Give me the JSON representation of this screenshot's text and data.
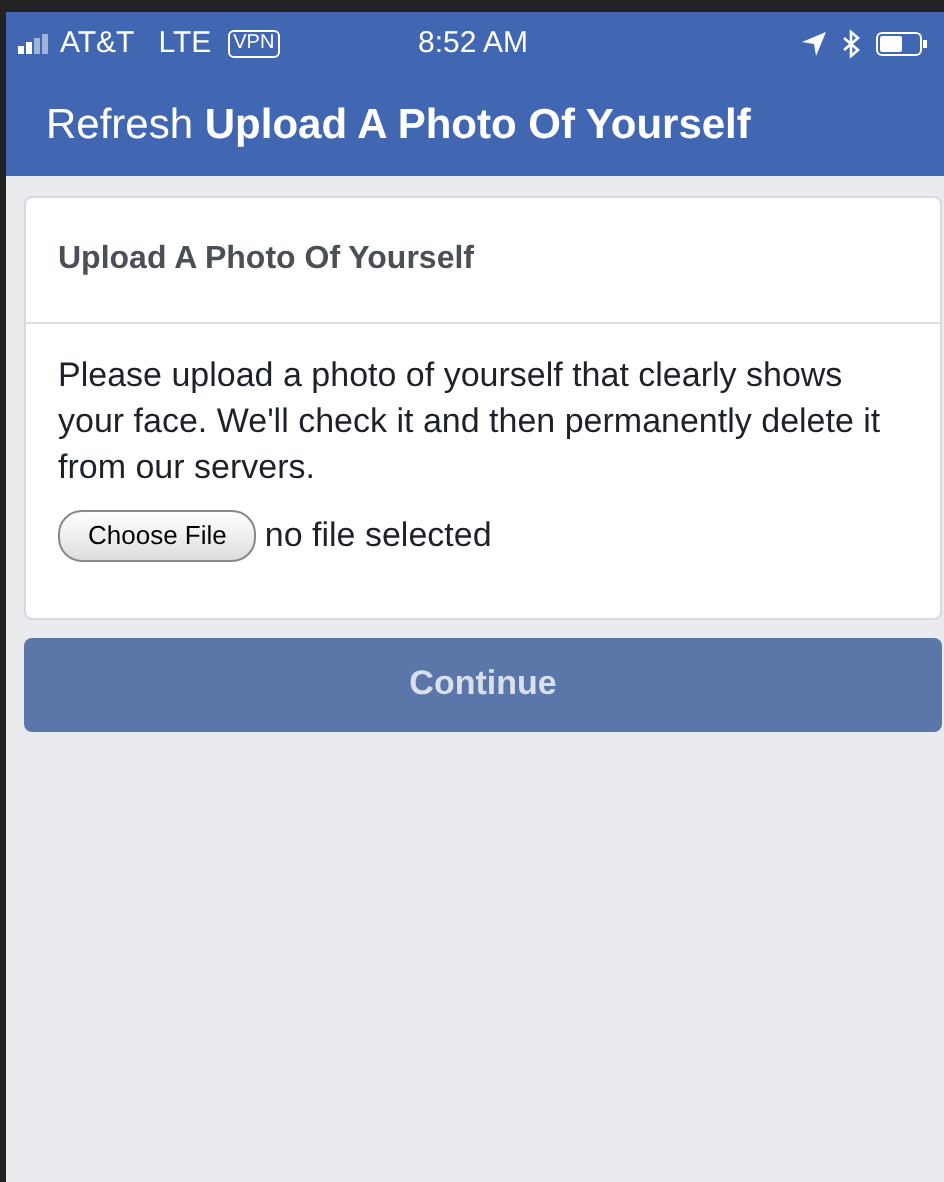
{
  "status_bar": {
    "carrier": "AT&T",
    "network": "LTE",
    "vpn": "VPN",
    "time": "8:52 AM"
  },
  "nav_bar": {
    "title": "Refresh **Upload A Photo Of Yourself**"
  },
  "card": {
    "heading": "Upload A Photo Of Yourself",
    "text": "Please upload a photo of yourself that clearly shows your face. We'll check it and then permanently delete it from our servers.",
    "file_button": "Choose File",
    "file_status": "no file selected"
  },
  "buttons": [
    {
      "label": "Continue",
      "disabled": true
    }
  ]
}
